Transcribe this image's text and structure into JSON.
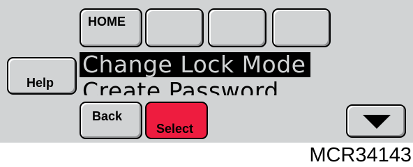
{
  "buttons": {
    "home": "HOME",
    "help": "Help",
    "back": "Back",
    "select": "Select"
  },
  "menu": {
    "selected_item": "Change Lock Mode",
    "next_item": "Create Password"
  },
  "figure_id": "MCR34143",
  "colors": {
    "screen_bg": "#d1d3d4",
    "select_button": "#ee1c3f",
    "highlight": "#000000"
  },
  "icons": {
    "scroll_down": "down-triangle-icon"
  }
}
